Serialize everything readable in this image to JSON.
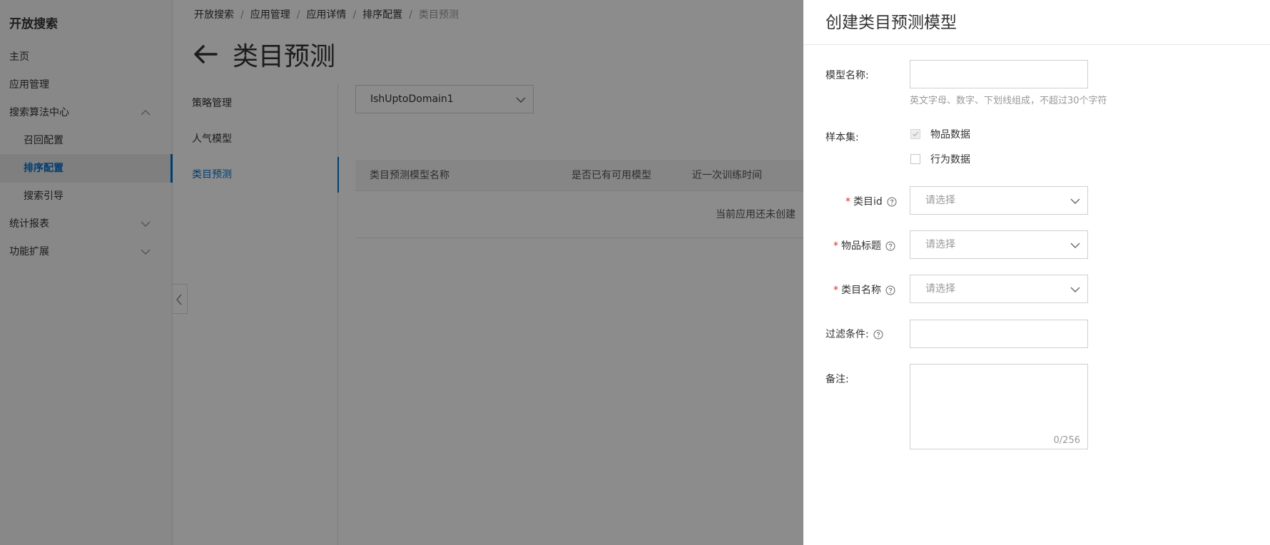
{
  "sidebar": {
    "brand": "开放搜索",
    "items": [
      {
        "label": "主页"
      },
      {
        "label": "应用管理"
      },
      {
        "label": "搜索算法中心"
      },
      {
        "label": "召回配置"
      },
      {
        "label": "排序配置"
      },
      {
        "label": "搜索引导"
      },
      {
        "label": "统计报表"
      },
      {
        "label": "功能扩展"
      }
    ],
    "active_item": "排序配置"
  },
  "breadcrumb": [
    "开放搜索",
    "应用管理",
    "应用详情",
    "排序配置",
    "类目预测"
  ],
  "breadcrumb_separator": "/",
  "page": {
    "title": "类目预测",
    "back_icon": "arrow-left-icon"
  },
  "subnav": {
    "items": [
      {
        "label": "策略管理"
      },
      {
        "label": "人气模型"
      },
      {
        "label": "类目预测"
      }
    ],
    "active_item": "类目预测"
  },
  "main": {
    "domain_select_value": "IshUptoDomain1",
    "table": {
      "columns": [
        "类目预测模型名称",
        "是否已有可用模型",
        "近一次训练时间"
      ],
      "empty_text": "当前应用还未创建"
    }
  },
  "drawer": {
    "title": "创建类目预测模型",
    "model_name": {
      "label": "模型名称:",
      "value": "",
      "help": "英文字母、数字、下划线组成，不超过30个字符"
    },
    "sample_set": {
      "label": "样本集:",
      "options": [
        {
          "label": "物品数据",
          "checked": true,
          "disabled": true
        },
        {
          "label": "行为数据",
          "checked": false,
          "disabled": false
        }
      ]
    },
    "category_id": {
      "label": "类目id",
      "required": true,
      "placeholder": "请选择"
    },
    "item_title": {
      "label": "物品标题",
      "required": true,
      "placeholder": "请选择"
    },
    "category_name": {
      "label": "类目名称",
      "required": true,
      "placeholder": "请选择"
    },
    "filter": {
      "label": "过滤条件:",
      "value": ""
    },
    "remark": {
      "label": "备注:",
      "value": "",
      "counter": "0/256"
    },
    "required_mark": "*"
  },
  "colors": {
    "accent": "#0070cc",
    "required": "#e0282e",
    "overlay": "rgba(0,0,0,0.45)",
    "sidebar_bg": "#f7f7f7"
  }
}
